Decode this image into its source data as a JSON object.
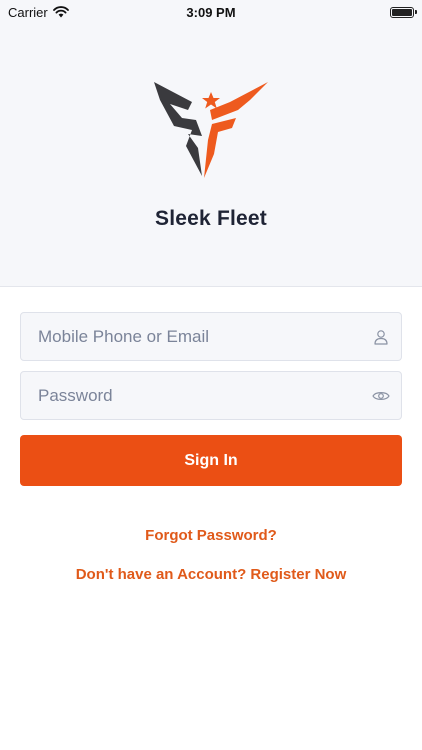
{
  "status_bar": {
    "carrier": "Carrier",
    "time": "3:09 PM",
    "icons": [
      "wifi-icon",
      "battery-icon"
    ]
  },
  "brand": {
    "name": "Sleek Fleet",
    "logo_colors": {
      "dark": "#3a3a3e",
      "accent": "#ee5a1e"
    }
  },
  "login_form": {
    "email_placeholder": "Mobile Phone or Email",
    "email_value": "",
    "email_icon": "user-icon",
    "password_placeholder": "Password",
    "password_value": "",
    "password_icon": "eye-icon",
    "signin_label": "Sign In"
  },
  "links": {
    "forgot_password": "Forgot Password?",
    "register": "Don't have an Account? Register Now"
  },
  "colors": {
    "primary": "#eb4f14",
    "link": "#e05a1a",
    "header_bg": "#f6f7fa",
    "text_dark": "#1f2435",
    "placeholder": "#7b8499"
  }
}
